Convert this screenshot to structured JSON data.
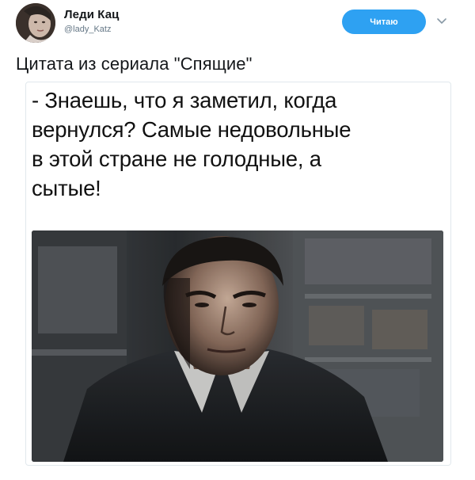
{
  "user": {
    "display_name": "Леди Кац",
    "username": "@lady_Katz",
    "avatar_icon": "user-avatar"
  },
  "follow_button": {
    "label": "Читаю",
    "color": "#2ea1f2"
  },
  "caret_icon": "chevron-down-icon",
  "tweet": {
    "text": "Цитата из сериала \"Спящие\""
  },
  "card": {
    "quote_lines": [
      "- Знаешь, что я заметил, когда",
      "вернулся? Самые недовольные",
      "в этой стране не голодные, а",
      "сытые!"
    ],
    "image_icon": "movie-still-image"
  }
}
